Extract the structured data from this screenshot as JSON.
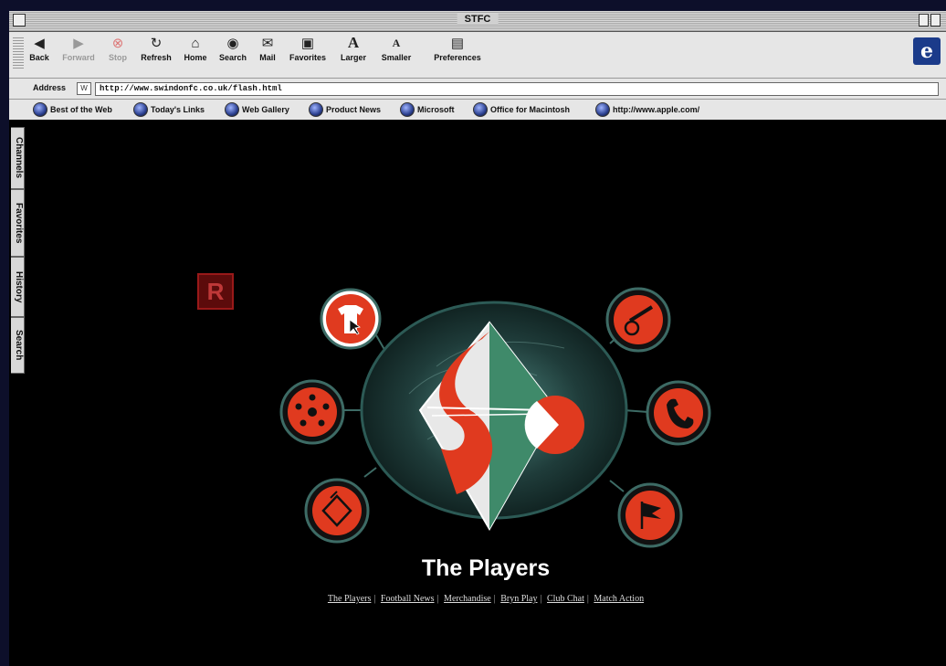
{
  "window": {
    "title": "STFC"
  },
  "toolbar": {
    "buttons": [
      {
        "label": "Back",
        "icon": "back-arrow-icon"
      },
      {
        "label": "Forward",
        "icon": "forward-arrow-icon"
      },
      {
        "label": "Stop",
        "icon": "stop-icon"
      },
      {
        "label": "Refresh",
        "icon": "refresh-icon"
      },
      {
        "label": "Home",
        "icon": "home-icon"
      },
      {
        "label": "Search",
        "icon": "search-icon"
      },
      {
        "label": "Mail",
        "icon": "mail-icon"
      },
      {
        "label": "Favorites",
        "icon": "favorites-icon"
      },
      {
        "label": "Larger",
        "icon": "larger-text-icon"
      },
      {
        "label": "Smaller",
        "icon": "smaller-text-icon"
      },
      {
        "label": "Preferences",
        "icon": "preferences-icon"
      }
    ]
  },
  "address": {
    "label": "Address",
    "url": "http://www.swindonfc.co.uk/flash.html"
  },
  "links": [
    "Best of the Web",
    "Today's Links",
    "Web Gallery",
    "Product News",
    "Microsoft",
    "Office for Macintosh",
    "http://www.apple.com/"
  ],
  "sidebar_tabs": [
    "Channels",
    "Favorites",
    "History",
    "Search"
  ],
  "content": {
    "badge": "R",
    "heading": "The Players",
    "nav_links": [
      "The Players",
      "Football News",
      "Merchandise",
      "Bryn Play",
      "Club Chat",
      "Match Action"
    ]
  },
  "colors": {
    "accent": "#e03a1f",
    "page_bg": "#000000",
    "toolbar_bg": "#e6e6e6"
  }
}
